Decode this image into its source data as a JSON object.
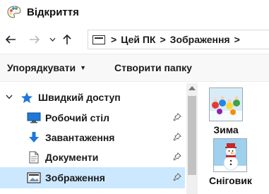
{
  "window": {
    "title": "Відкриття",
    "app_icon": "paint-palette-icon"
  },
  "navigation": {
    "back_icon": "arrow-left-icon",
    "forward_icon": "arrow-right-icon",
    "recent_icon": "chevron-down-icon",
    "up_icon": "arrow-up-icon"
  },
  "address": {
    "location_icon": "folder-window-icon",
    "separator": ">",
    "crumbs": [
      "Цей ПК",
      "Зображення"
    ]
  },
  "toolbar": {
    "organize_label": "Упорядкувати",
    "organize_caret": "▼",
    "new_folder_label": "Створити папку"
  },
  "sidebar": {
    "items": [
      {
        "label": "Швидкий доступ",
        "icon": "star-icon",
        "expanded": true
      },
      {
        "label": "Робочий стіл",
        "icon": "desktop-icon",
        "pinned": true
      },
      {
        "label": "Завантаження",
        "icon": "download-arrow-icon",
        "pinned": true
      },
      {
        "label": "Документи",
        "icon": "document-icon",
        "pinned": true
      },
      {
        "label": "Зображення",
        "icon": "pictures-icon",
        "pinned": true,
        "selected": true
      }
    ]
  },
  "files": [
    {
      "name": "Зима",
      "icon": "winter-scene-thumbnail"
    },
    {
      "name": "Сніговик",
      "icon": "snowman-thumbnail"
    }
  ],
  "colors": {
    "selection": "#cce8ff",
    "accent_blue": "#1e78d7",
    "scrollbar_thumb": "#c2c2c2"
  }
}
